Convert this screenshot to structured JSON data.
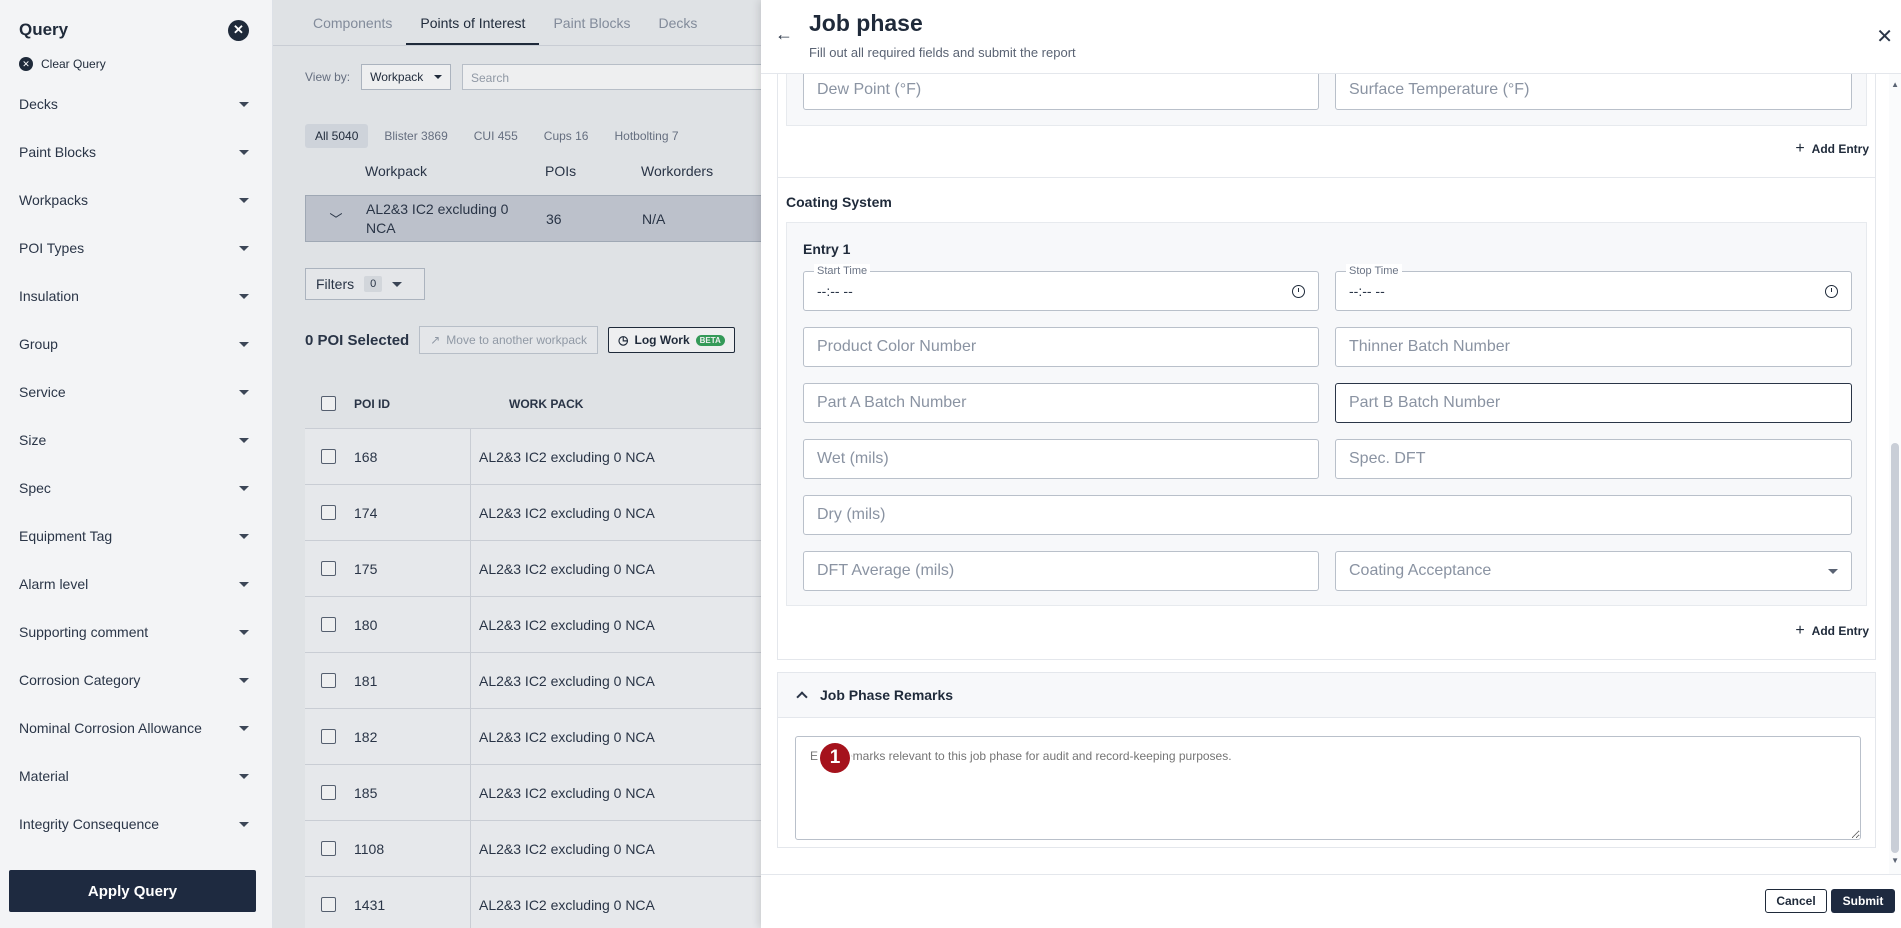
{
  "sidebar": {
    "title": "Query",
    "clear_label": "Clear Query",
    "items": [
      {
        "label": "Decks"
      },
      {
        "label": "Paint Blocks"
      },
      {
        "label": "Workpacks"
      },
      {
        "label": "POI Types"
      },
      {
        "label": "Insulation"
      },
      {
        "label": "Group"
      },
      {
        "label": "Service"
      },
      {
        "label": "Size"
      },
      {
        "label": "Spec"
      },
      {
        "label": "Equipment Tag"
      },
      {
        "label": "Alarm level"
      },
      {
        "label": "Supporting comment"
      },
      {
        "label": "Corrosion Category"
      },
      {
        "label": "Nominal Corrosion Allowance"
      },
      {
        "label": "Material"
      },
      {
        "label": "Integrity Consequence"
      }
    ],
    "apply_label": "Apply Query"
  },
  "main": {
    "tabs": [
      {
        "label": "Components"
      },
      {
        "label": "Points of Interest"
      },
      {
        "label": "Paint Blocks"
      },
      {
        "label": "Decks"
      }
    ],
    "view_by_label": "View by:",
    "view_by_value": "Workpack",
    "search_placeholder": "Search",
    "chips": [
      {
        "label": "All 5040"
      },
      {
        "label": "Blister 3869"
      },
      {
        "label": "CUI 455"
      },
      {
        "label": "Cups 16"
      },
      {
        "label": "Hotbolting 7"
      }
    ],
    "workpack_headers": {
      "workpack": "Workpack",
      "pois": "POIs",
      "workorders": "Workorders"
    },
    "workpack_row": {
      "name_line1": "AL2&3 IC2 excluding 0",
      "name_line2": "NCA",
      "pois": "36",
      "workorders": "N/A"
    },
    "filters_label": "Filters",
    "filters_count": "0",
    "selected_text": "0 POI Selected",
    "move_label": "Move to another workpack",
    "log_work_label": "Log Work",
    "beta_label": "BETA",
    "table_headers": {
      "poi_id": "POI ID",
      "work_pack": "WORK PACK"
    },
    "rows": [
      {
        "id": "168",
        "wp": "AL2&3 IC2 excluding 0 NCA"
      },
      {
        "id": "174",
        "wp": "AL2&3 IC2 excluding 0 NCA"
      },
      {
        "id": "175",
        "wp": "AL2&3 IC2 excluding 0 NCA"
      },
      {
        "id": "180",
        "wp": "AL2&3 IC2 excluding 0 NCA"
      },
      {
        "id": "181",
        "wp": "AL2&3 IC2 excluding 0 NCA"
      },
      {
        "id": "182",
        "wp": "AL2&3 IC2 excluding 0 NCA"
      },
      {
        "id": "185",
        "wp": "AL2&3 IC2 excluding 0 NCA"
      },
      {
        "id": "1108",
        "wp": "AL2&3 IC2 excluding 0 NCA"
      },
      {
        "id": "1431",
        "wp": "AL2&3 IC2 excluding 0 NCA"
      }
    ]
  },
  "drawer": {
    "title": "Job phase",
    "subtitle": "Fill out all required fields and submit the report",
    "env_fields": {
      "dew_point": "Dew Point (°F)",
      "surface_temp": "Surface Temperature (°F)"
    },
    "add_entry_label": "Add Entry",
    "coating_title": "Coating System",
    "entry_title": "Entry 1",
    "start_time_label": "Start Time",
    "stop_time_label": "Stop Time",
    "time_placeholder": "--:-- --",
    "fields": {
      "product_color": "Product Color Number",
      "thinner_batch": "Thinner Batch Number",
      "part_a": "Part A Batch Number",
      "part_b": "Part B Batch Number",
      "wet": "Wet (mils)",
      "spec_dft": "Spec. DFT",
      "dry": "Dry (mils)",
      "dft_avg": "DFT Average (mils)",
      "coating_acceptance": "Coating Acceptance"
    },
    "remarks_title": "Job Phase Remarks",
    "remarks_placeholder": "Enter remarks relevant to this job phase for audit and record-keeping purposes.",
    "marker_number": "1",
    "cancel_label": "Cancel",
    "submit_label": "Submit"
  }
}
